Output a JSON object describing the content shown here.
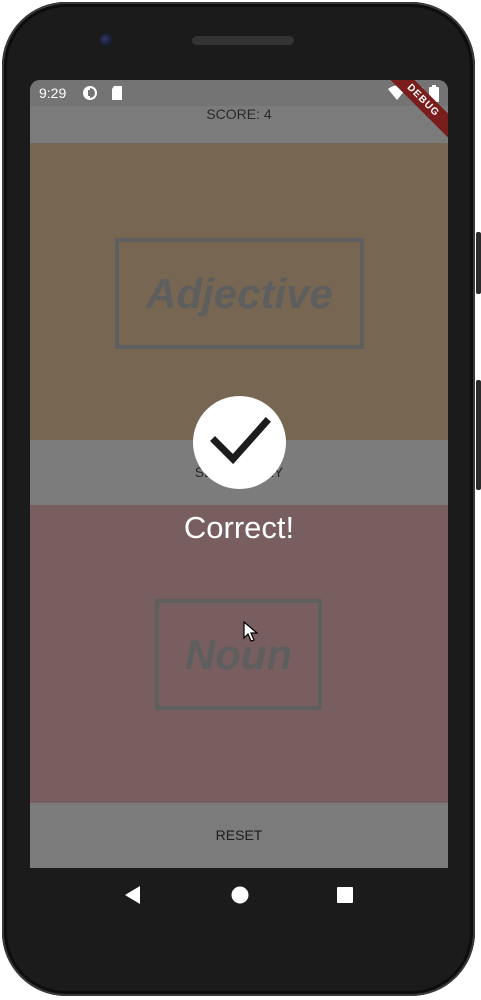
{
  "status_bar": {
    "time": "9:29"
  },
  "debug_ribbon": {
    "label": "DEBUG"
  },
  "score": {
    "label": "SCORE: 4"
  },
  "word_top": {
    "label": "Adjective"
  },
  "word_bottom": {
    "label": "Noun"
  },
  "middle_button": {
    "label": "SECONDARY"
  },
  "reset_button": {
    "label": "RESET"
  },
  "overlay": {
    "message": "Correct!"
  },
  "icons": [
    "checkmark-icon",
    "back-icon",
    "home-icon",
    "recents-icon",
    "wifi-icon",
    "battery-icon",
    "signal-icon"
  ],
  "colors": {
    "top_panel": "#776752",
    "bottom_panel": "#795e60",
    "scrim": "#7b7b7b",
    "ribbon": "#7a1d1d"
  }
}
